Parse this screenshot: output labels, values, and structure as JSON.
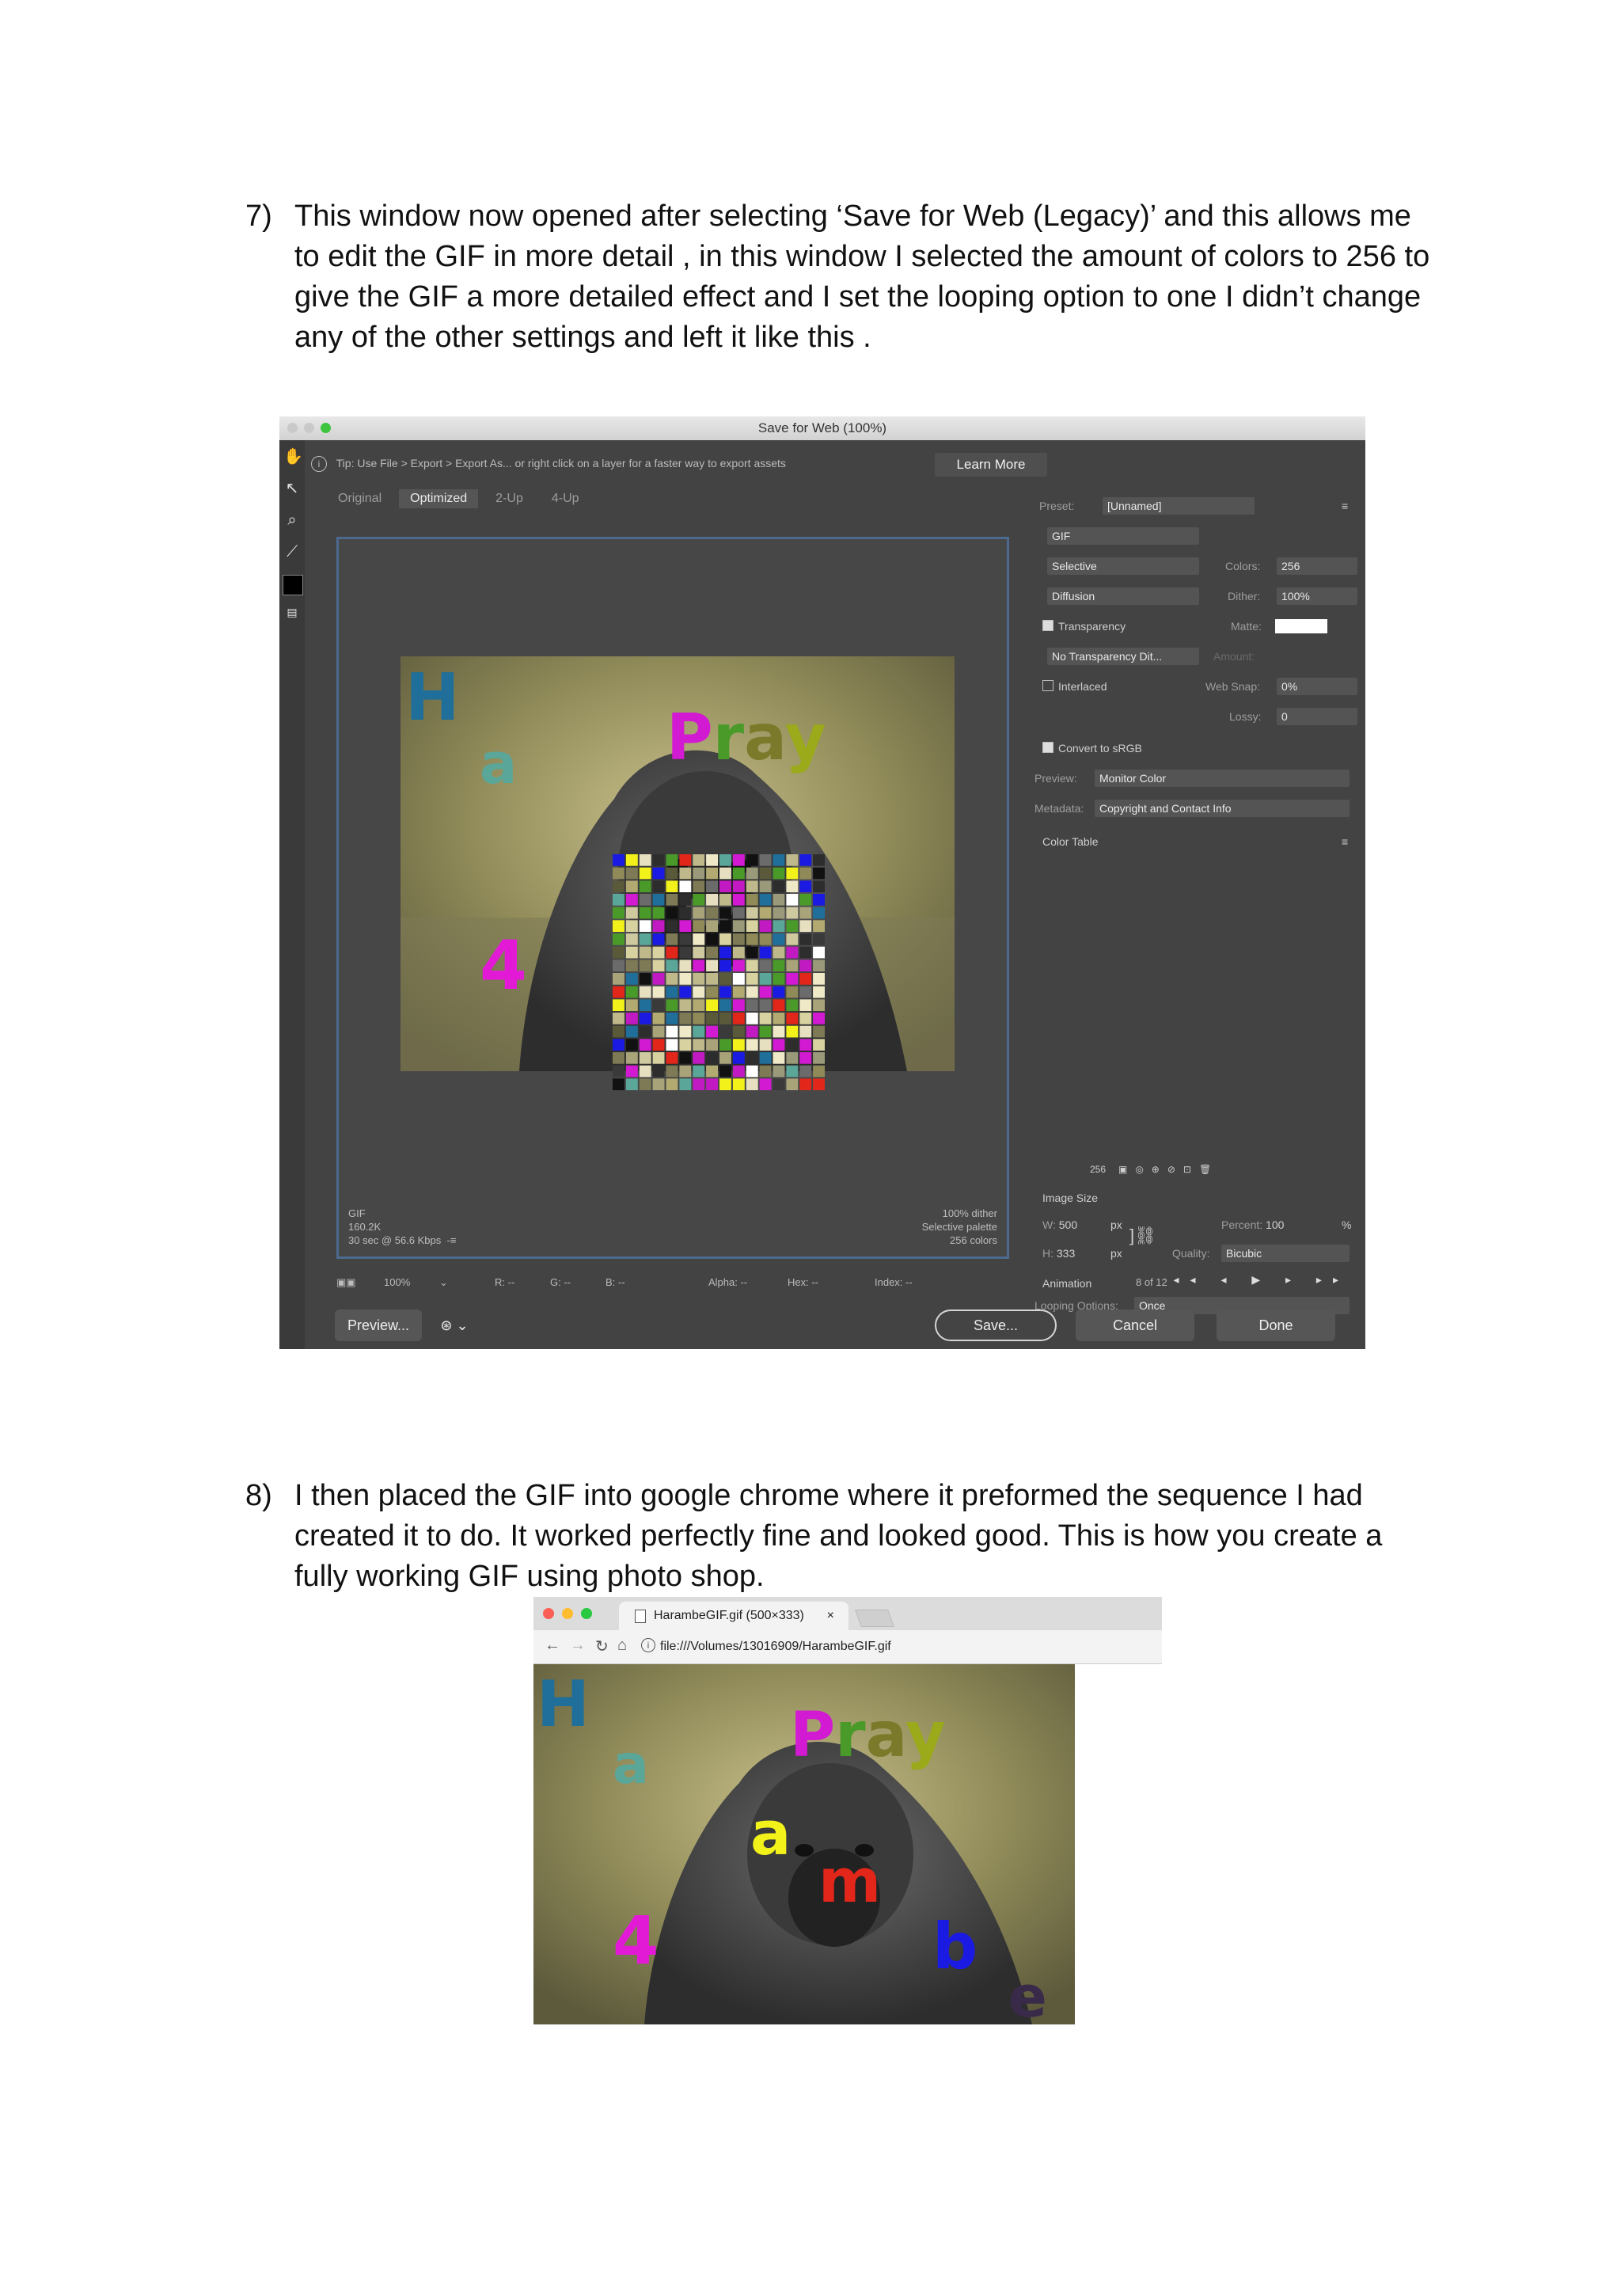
{
  "step7": {
    "number": "7)",
    "text": "This window now opened after selecting ‘Save for Web (Legacy)’ and this allows me to edit the GIF in more detail , in this window I selected the amount of colors to 256 to give the GIF a more detailed effect and I set the looping option to one I didn’t change any of the other settings and left it like this ."
  },
  "step8": {
    "number": "8)",
    "text": "I then placed the GIF into google chrome where it preformed the sequence I had created it to do. It worked perfectly fine and looked good. This is how you create a fully working GIF using photo shop."
  },
  "photoshop": {
    "title": "Save for Web (100%)",
    "tip": "Tip: Use File > Export > Export As... or right click on a layer for a faster way to export assets",
    "learn_more": "Learn More",
    "tabs": [
      "Original",
      "Optimized",
      "2-Up",
      "4-Up"
    ],
    "image_letters": {
      "H": "H",
      "a": "a",
      "Pray": "Pray",
      "four": "4"
    },
    "info_left": "GIF\n160.2K\n30 sec @ 56.6 Kbps  -≡",
    "info_right": "100% dither\nSelective palette\n256 colors",
    "status": {
      "zoom": "100%",
      "r": "R: --",
      "g": "G: --",
      "b": "B: --",
      "alpha": "Alpha: --",
      "hex": "Hex: --",
      "index": "Index: --",
      "frame": "8 of 12"
    },
    "buttons": {
      "preview": "Preview...",
      "save": "Save...",
      "cancel": "Cancel",
      "done": "Done"
    },
    "settings": {
      "preset_label": "Preset:",
      "preset_value": "[Unnamed]",
      "format": "GIF",
      "reduction": "Selective",
      "colors_label": "Colors:",
      "colors_value": "256",
      "dither_algo": "Diffusion",
      "dither_label": "Dither:",
      "dither_value": "100%",
      "transparency": "Transparency",
      "matte_label": "Matte:",
      "transparency_dither": "No Transparency Dit...",
      "amount_label": "Amount:",
      "interlaced": "Interlaced",
      "websnap_label": "Web Snap:",
      "websnap_value": "0%",
      "lossy_label": "Lossy:",
      "lossy_value": "0",
      "convert_srgb": "Convert to sRGB",
      "preview_label": "Preview:",
      "preview_value": "Monitor Color",
      "metadata_label": "Metadata:",
      "metadata_value": "Copyright and Contact Info",
      "color_table": "Color Table",
      "color_count": "256",
      "image_size": "Image Size",
      "w_label": "W:",
      "w_value": "500",
      "h_label": "H:",
      "h_value": "333",
      "px": "px",
      "percent_label": "Percent:",
      "percent_value": "100",
      "percent_unit": "%",
      "quality_label": "Quality:",
      "quality_value": "Bicubic",
      "animation": "Animation",
      "looping_label": "Looping Options:",
      "looping_value": "Once"
    }
  },
  "chrome": {
    "tab_title": "HarambeGIF.gif (500×333)",
    "tab_close": "×",
    "url": "file:///Volumes/13016909/HarambeGIF.gif",
    "letters": {
      "H": "H",
      "a": "a",
      "Pray": "Pray",
      "a2": "a",
      "m": "m",
      "b": "b",
      "e": "e",
      "four": "4"
    }
  },
  "colors": {
    "ps_bg": "#434343",
    "canvas_border": "#4c6a8f",
    "letter_H": "#1f6f9a",
    "letter_a": "#5aa79a",
    "letter_P": "#d21ad2",
    "letter_r": "#4a9a2a",
    "letter_a_pray": "#7a7a2a",
    "letter_y": "#9aaa1a",
    "letter_4": "#e21ad6",
    "letter_a_yellow": "#f2f21a",
    "letter_m": "#e2261a",
    "letter_b": "#1a1ae2",
    "letter_e": "#3a2a4a"
  }
}
